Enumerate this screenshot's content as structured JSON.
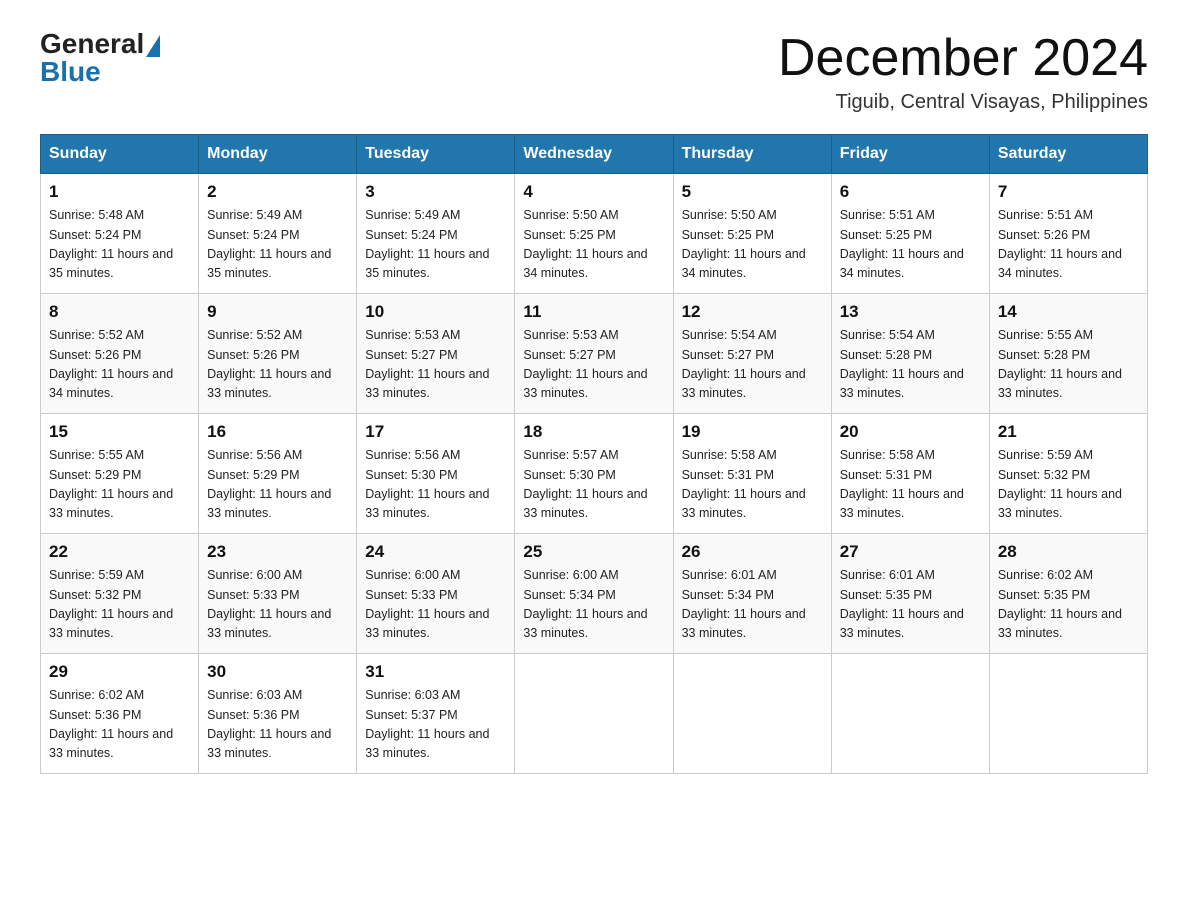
{
  "header": {
    "logo_general": "General",
    "logo_blue": "Blue",
    "month_title": "December 2024",
    "location": "Tiguib, Central Visayas, Philippines"
  },
  "days_of_week": [
    "Sunday",
    "Monday",
    "Tuesday",
    "Wednesday",
    "Thursday",
    "Friday",
    "Saturday"
  ],
  "weeks": [
    [
      {
        "day": "1",
        "sunrise": "5:48 AM",
        "sunset": "5:24 PM",
        "daylight": "11 hours and 35 minutes."
      },
      {
        "day": "2",
        "sunrise": "5:49 AM",
        "sunset": "5:24 PM",
        "daylight": "11 hours and 35 minutes."
      },
      {
        "day": "3",
        "sunrise": "5:49 AM",
        "sunset": "5:24 PM",
        "daylight": "11 hours and 35 minutes."
      },
      {
        "day": "4",
        "sunrise": "5:50 AM",
        "sunset": "5:25 PM",
        "daylight": "11 hours and 34 minutes."
      },
      {
        "day": "5",
        "sunrise": "5:50 AM",
        "sunset": "5:25 PM",
        "daylight": "11 hours and 34 minutes."
      },
      {
        "day": "6",
        "sunrise": "5:51 AM",
        "sunset": "5:25 PM",
        "daylight": "11 hours and 34 minutes."
      },
      {
        "day": "7",
        "sunrise": "5:51 AM",
        "sunset": "5:26 PM",
        "daylight": "11 hours and 34 minutes."
      }
    ],
    [
      {
        "day": "8",
        "sunrise": "5:52 AM",
        "sunset": "5:26 PM",
        "daylight": "11 hours and 34 minutes."
      },
      {
        "day": "9",
        "sunrise": "5:52 AM",
        "sunset": "5:26 PM",
        "daylight": "11 hours and 33 minutes."
      },
      {
        "day": "10",
        "sunrise": "5:53 AM",
        "sunset": "5:27 PM",
        "daylight": "11 hours and 33 minutes."
      },
      {
        "day": "11",
        "sunrise": "5:53 AM",
        "sunset": "5:27 PM",
        "daylight": "11 hours and 33 minutes."
      },
      {
        "day": "12",
        "sunrise": "5:54 AM",
        "sunset": "5:27 PM",
        "daylight": "11 hours and 33 minutes."
      },
      {
        "day": "13",
        "sunrise": "5:54 AM",
        "sunset": "5:28 PM",
        "daylight": "11 hours and 33 minutes."
      },
      {
        "day": "14",
        "sunrise": "5:55 AM",
        "sunset": "5:28 PM",
        "daylight": "11 hours and 33 minutes."
      }
    ],
    [
      {
        "day": "15",
        "sunrise": "5:55 AM",
        "sunset": "5:29 PM",
        "daylight": "11 hours and 33 minutes."
      },
      {
        "day": "16",
        "sunrise": "5:56 AM",
        "sunset": "5:29 PM",
        "daylight": "11 hours and 33 minutes."
      },
      {
        "day": "17",
        "sunrise": "5:56 AM",
        "sunset": "5:30 PM",
        "daylight": "11 hours and 33 minutes."
      },
      {
        "day": "18",
        "sunrise": "5:57 AM",
        "sunset": "5:30 PM",
        "daylight": "11 hours and 33 minutes."
      },
      {
        "day": "19",
        "sunrise": "5:58 AM",
        "sunset": "5:31 PM",
        "daylight": "11 hours and 33 minutes."
      },
      {
        "day": "20",
        "sunrise": "5:58 AM",
        "sunset": "5:31 PM",
        "daylight": "11 hours and 33 minutes."
      },
      {
        "day": "21",
        "sunrise": "5:59 AM",
        "sunset": "5:32 PM",
        "daylight": "11 hours and 33 minutes."
      }
    ],
    [
      {
        "day": "22",
        "sunrise": "5:59 AM",
        "sunset": "5:32 PM",
        "daylight": "11 hours and 33 minutes."
      },
      {
        "day": "23",
        "sunrise": "6:00 AM",
        "sunset": "5:33 PM",
        "daylight": "11 hours and 33 minutes."
      },
      {
        "day": "24",
        "sunrise": "6:00 AM",
        "sunset": "5:33 PM",
        "daylight": "11 hours and 33 minutes."
      },
      {
        "day": "25",
        "sunrise": "6:00 AM",
        "sunset": "5:34 PM",
        "daylight": "11 hours and 33 minutes."
      },
      {
        "day": "26",
        "sunrise": "6:01 AM",
        "sunset": "5:34 PM",
        "daylight": "11 hours and 33 minutes."
      },
      {
        "day": "27",
        "sunrise": "6:01 AM",
        "sunset": "5:35 PM",
        "daylight": "11 hours and 33 minutes."
      },
      {
        "day": "28",
        "sunrise": "6:02 AM",
        "sunset": "5:35 PM",
        "daylight": "11 hours and 33 minutes."
      }
    ],
    [
      {
        "day": "29",
        "sunrise": "6:02 AM",
        "sunset": "5:36 PM",
        "daylight": "11 hours and 33 minutes."
      },
      {
        "day": "30",
        "sunrise": "6:03 AM",
        "sunset": "5:36 PM",
        "daylight": "11 hours and 33 minutes."
      },
      {
        "day": "31",
        "sunrise": "6:03 AM",
        "sunset": "5:37 PM",
        "daylight": "11 hours and 33 minutes."
      },
      null,
      null,
      null,
      null
    ]
  ]
}
